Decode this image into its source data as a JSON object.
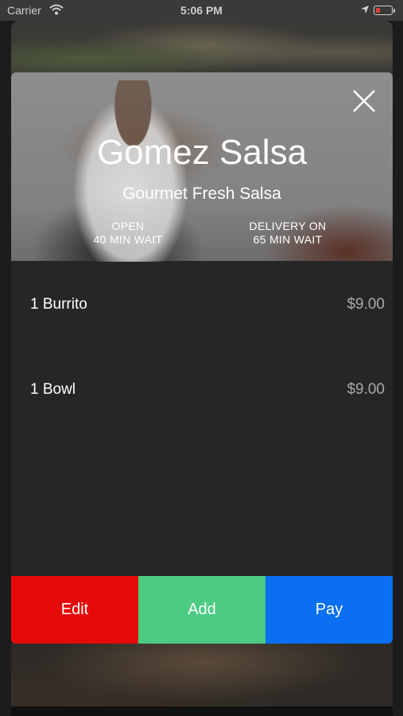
{
  "status_bar": {
    "carrier": "Carrier",
    "time": "5:06 PM",
    "battery_color": "#e0413a"
  },
  "restaurant": {
    "name": "Gomez Salsa",
    "tagline": "Gourmet Fresh Salsa",
    "status": "OPEN",
    "wait": "40 MIN WAIT",
    "delivery_status": "DELIVERY ON",
    "delivery_wait": "65 MIN WAIT"
  },
  "order": {
    "items": [
      {
        "label": "1 Burrito",
        "price": "$9.00"
      },
      {
        "label": "1 Bowl",
        "price": "$9.00"
      }
    ]
  },
  "actions": {
    "edit_label": "Edit",
    "add_label": "Add",
    "pay_label": "Pay",
    "edit_color": "#e50a0a",
    "add_color": "#4bcc82",
    "pay_color": "#0a6ff0"
  },
  "icons": {
    "close": "close-icon",
    "wifi": "wifi-icon",
    "location": "location-arrow-icon",
    "battery": "battery-icon"
  }
}
